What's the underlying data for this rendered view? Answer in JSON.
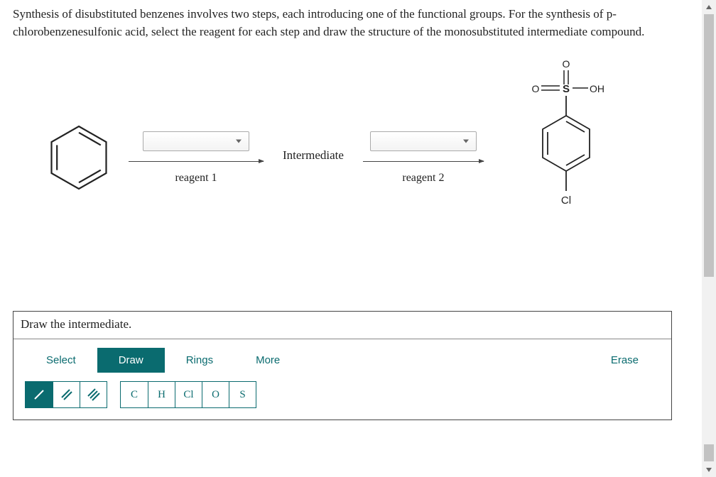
{
  "question": {
    "text": "Synthesis of disubstituted benzenes involves two steps, each introducing one of the functional groups. For the synthesis of p-chlorobenzenesulfonic acid, select the reagent for each step and draw the structure of the monosubstituted intermediate compound."
  },
  "reaction": {
    "start_label": "",
    "step1_label": "reagent 1",
    "intermediate_label": "Intermediate",
    "step2_label": "reagent 2",
    "reagent1_selected": "",
    "reagent2_selected": "",
    "product_top_left": "O",
    "product_top_mid": "O",
    "product_s": "S",
    "product_oh": "OH",
    "product_cl": "Cl"
  },
  "draw": {
    "header": "Draw the intermediate.",
    "tabs": {
      "select": "Select",
      "draw": "Draw",
      "rings": "Rings",
      "more": "More"
    },
    "erase": "Erase",
    "elements": {
      "c": "C",
      "h": "H",
      "cl": "Cl",
      "o": "O",
      "s": "S"
    }
  }
}
